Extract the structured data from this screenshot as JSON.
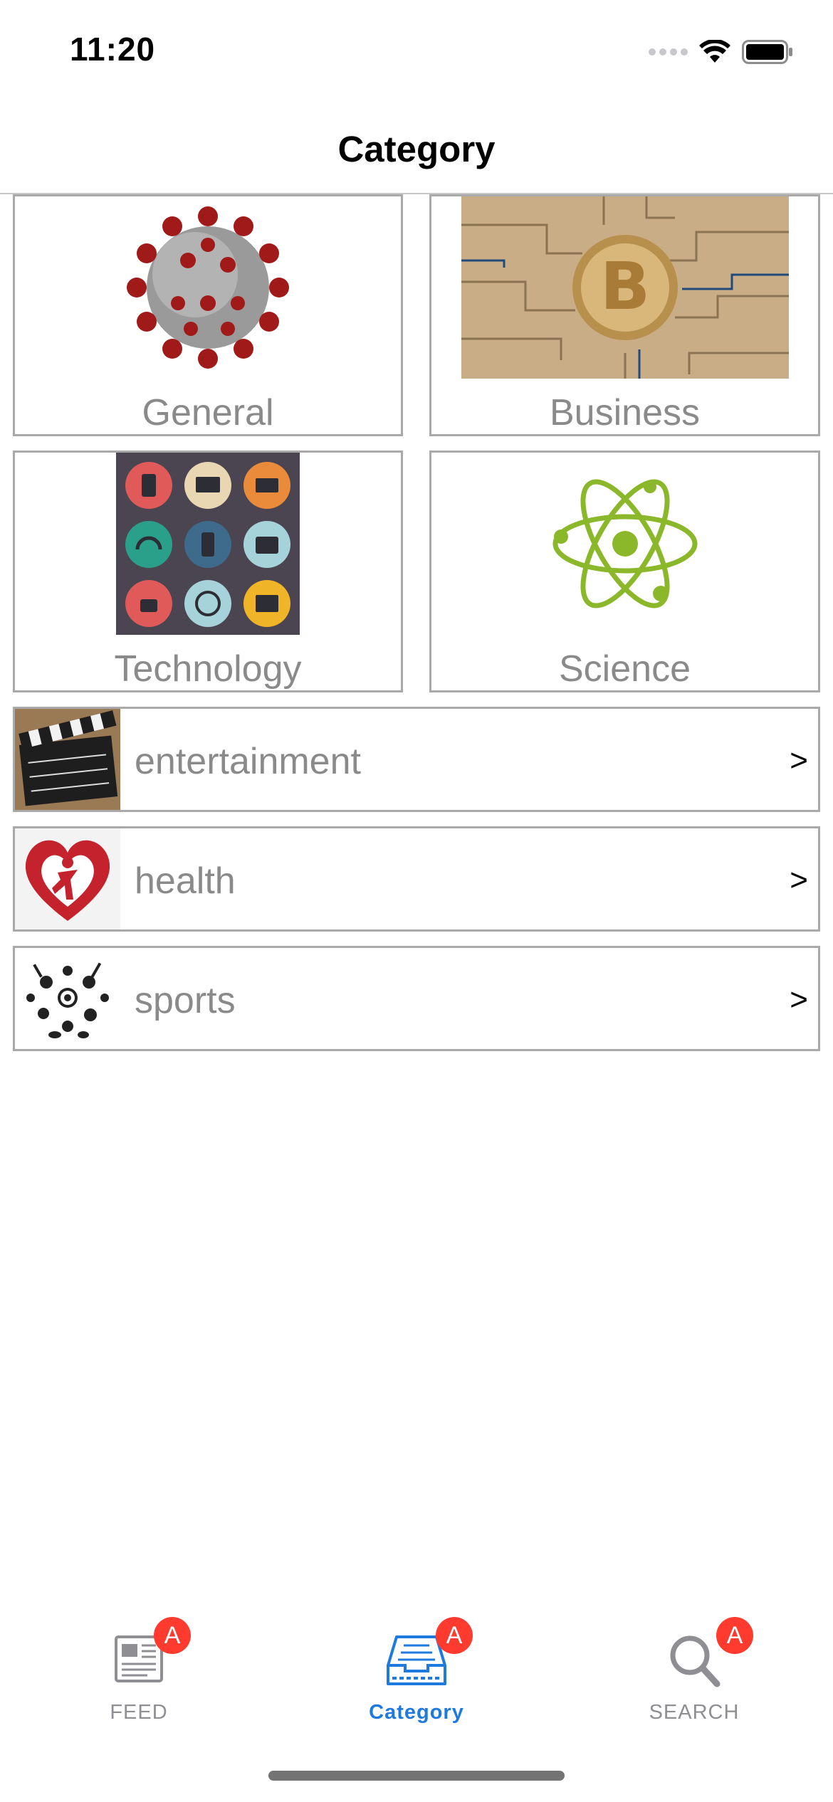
{
  "status_bar": {
    "time": "11:20"
  },
  "nav": {
    "title": "Category"
  },
  "tiles": [
    {
      "label": "General"
    },
    {
      "label": "Business"
    },
    {
      "label": "Technology"
    },
    {
      "label": "Science"
    }
  ],
  "rows": [
    {
      "label": "entertainment",
      "chevron": ">"
    },
    {
      "label": "health",
      "chevron": ">"
    },
    {
      "label": "sports",
      "chevron": ">"
    }
  ],
  "tab_bar": {
    "active": "Category",
    "tabs": [
      {
        "label": "FEED",
        "badge": "A"
      },
      {
        "label": "Category",
        "badge": "A"
      },
      {
        "label": "SEARCH",
        "badge": "A"
      }
    ]
  },
  "colors": {
    "accent": "#1f7ae0",
    "badge": "#ff3b30",
    "border": "#a9a9a9",
    "label_gray": "#8a8a8a"
  }
}
